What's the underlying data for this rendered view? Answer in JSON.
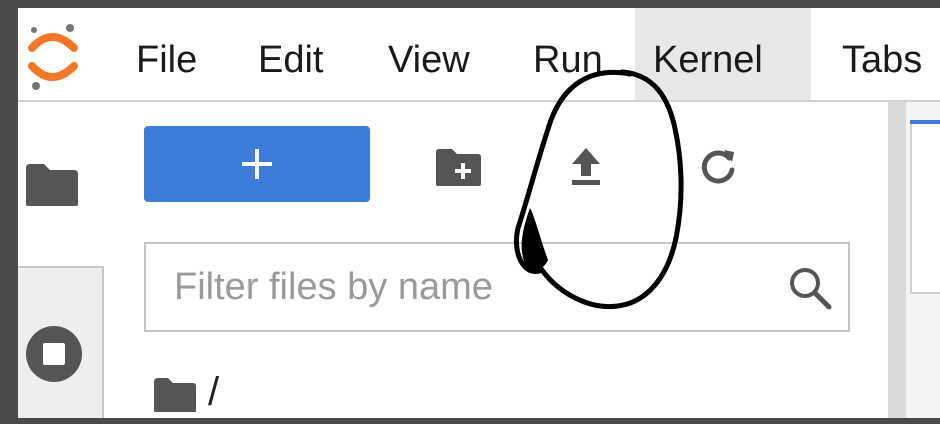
{
  "menubar": {
    "items": [
      {
        "label": "File"
      },
      {
        "label": "Edit"
      },
      {
        "label": "View"
      },
      {
        "label": "Run"
      },
      {
        "label": "Kernel"
      },
      {
        "label": "Tabs"
      }
    ],
    "active_item": "Kernel"
  },
  "logo": {
    "icon": "jupyter-logo",
    "color": "#f37726"
  },
  "activity_bar": {
    "items": [
      {
        "icon": "folder-icon"
      },
      {
        "icon": "stop-circle-icon"
      }
    ]
  },
  "file_browser": {
    "new_button": {
      "icon": "plus-icon",
      "label": "+",
      "color": "#3b7dd8"
    },
    "toolbar": [
      {
        "icon": "new-folder-icon"
      },
      {
        "icon": "upload-icon"
      },
      {
        "icon": "refresh-icon"
      }
    ],
    "filter": {
      "placeholder": "Filter files by name",
      "value": "",
      "icon": "search-icon"
    },
    "breadcrumb": {
      "icon": "folder-icon",
      "path": "/"
    }
  },
  "annotation": {
    "shape": "hand-drawn circle around upload button",
    "color": "#000000"
  }
}
